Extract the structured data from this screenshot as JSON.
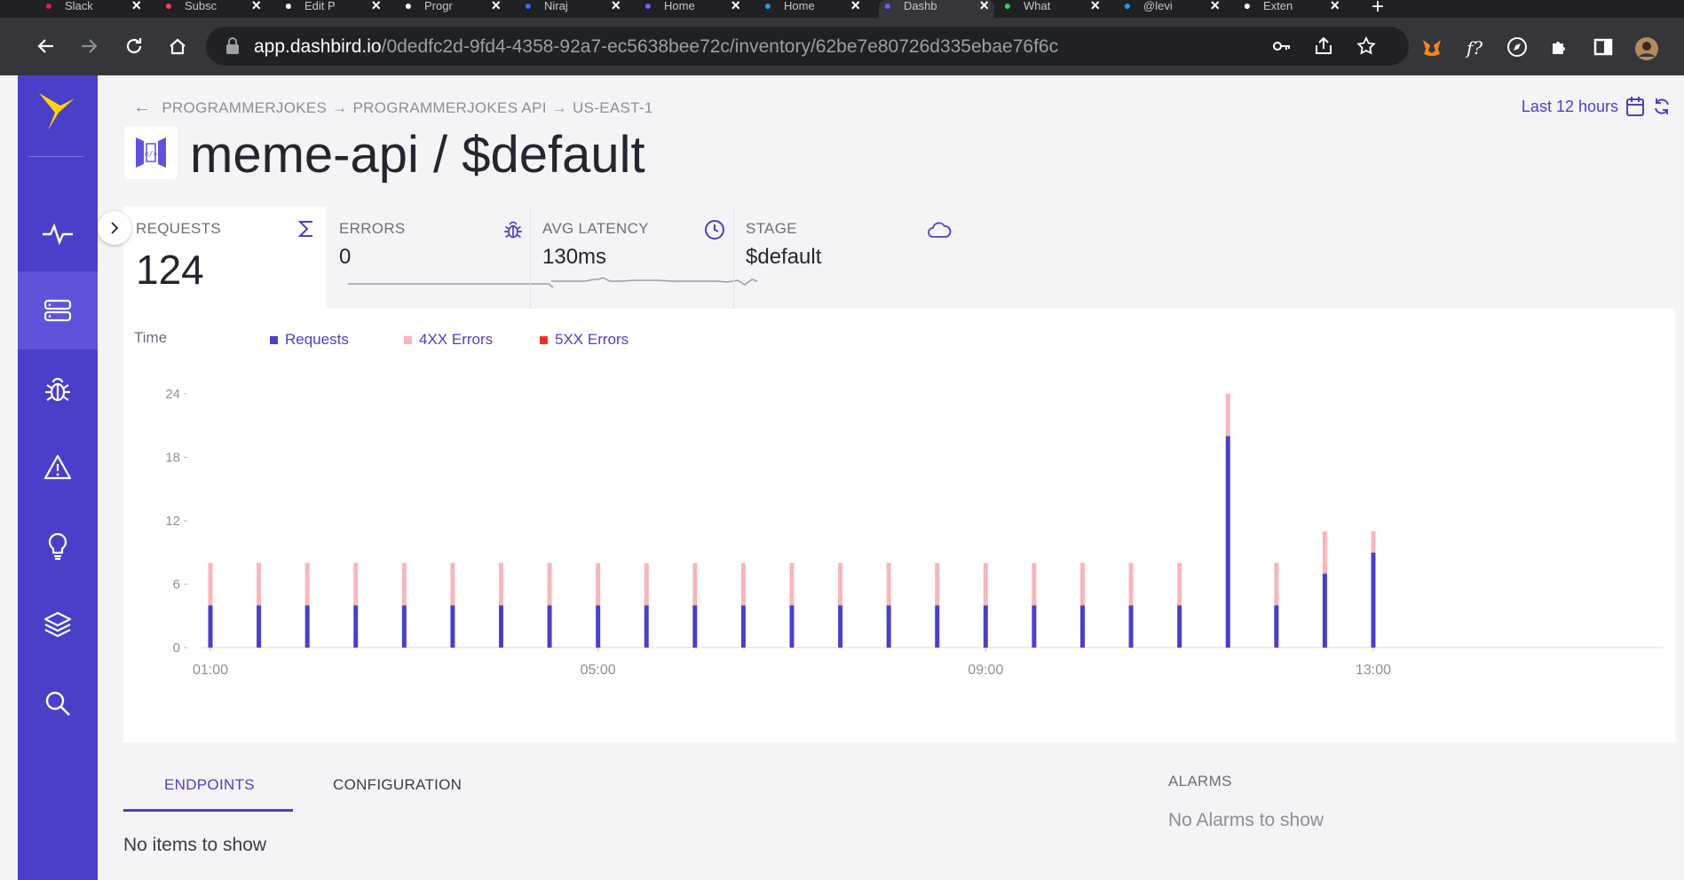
{
  "browser": {
    "tabs": [
      {
        "title": "Slack",
        "icon": "slack-icon",
        "color": "#e01e5a"
      },
      {
        "title": "Subsc",
        "icon": "swirl-icon",
        "color": "#ff3b5c"
      },
      {
        "title": "Edit P",
        "icon": "dollar-icon",
        "color": "#ffffff"
      },
      {
        "title": "Progr",
        "icon": "dollar-icon",
        "color": "#ffffff"
      },
      {
        "title": "Niraj",
        "icon": "circle-icon",
        "color": "#2f6fed"
      },
      {
        "title": "Home",
        "icon": "s-icon",
        "color": "#7b5cff"
      },
      {
        "title": "Home",
        "icon": "twitter-icon",
        "color": "#1d9bf0"
      },
      {
        "title": "Dashb",
        "icon": "dashbird-icon",
        "color": "#6d5dfc"
      },
      {
        "title": "What",
        "icon": "whatsapp-icon",
        "color": "#25d366"
      },
      {
        "title": "@levi",
        "icon": "twitter-icon",
        "color": "#1d9bf0"
      },
      {
        "title": "Exten",
        "icon": "puzzle-icon",
        "color": "#ffffff"
      }
    ],
    "url_host": "app.dashbird.io",
    "url_path": "/0dedfc2d-9fd4-4358-92a7-ec5638bee72c/inventory/62be7e80726d335ebae76f6c"
  },
  "breadcrumb": {
    "arrow": "←",
    "items": [
      "PROGRAMMERJOKES",
      "PROGRAMMERJOKES API",
      "US-EAST-1"
    ],
    "separator": "→"
  },
  "time_range": "Last 12 hours",
  "title": "meme-api / $default",
  "stats": {
    "requests": {
      "label": "REQUESTS",
      "value": "124"
    },
    "errors": {
      "label": "ERRORS",
      "value": "0"
    },
    "latency": {
      "label": "AVG LATENCY",
      "value": "130ms"
    },
    "stage": {
      "label": "STAGE",
      "value": "$default"
    }
  },
  "colors": {
    "brand": "#4a3fc8",
    "requests": "#4a3fc8",
    "errors_4xx": "#f7b6bc",
    "errors_5xx": "#f2301f"
  },
  "chart_data": {
    "type": "bar",
    "stacked": true,
    "x_label": "Time",
    "legend": [
      "Requests",
      "4XX Errors",
      "5XX Errors"
    ],
    "x_ticks": [
      "01:00",
      "05:00",
      "09:00",
      "13:00"
    ],
    "y_ticks": [
      0,
      6,
      12,
      18,
      24
    ],
    "ylim": [
      0,
      25
    ],
    "categories": [
      "01:00",
      "01:30",
      "02:00",
      "02:30",
      "03:00",
      "03:30",
      "04:00",
      "04:30",
      "05:00",
      "05:30",
      "06:00",
      "06:30",
      "07:00",
      "07:30",
      "08:00",
      "08:30",
      "09:00",
      "09:30",
      "10:00",
      "10:30",
      "11:00",
      "11:30",
      "12:00",
      "12:30",
      "13:00"
    ],
    "series": [
      {
        "name": "Requests",
        "values": [
          4,
          4,
          4,
          4,
          4,
          4,
          4,
          4,
          4,
          4,
          4,
          4,
          4,
          4,
          4,
          4,
          4,
          4,
          4,
          4,
          4,
          20,
          4,
          7,
          9
        ]
      },
      {
        "name": "4XX Errors",
        "values": [
          4,
          4,
          4,
          4,
          4,
          4,
          4,
          4,
          4,
          4,
          4,
          4,
          4,
          4,
          4,
          4,
          4,
          4,
          4,
          4,
          4,
          4,
          4,
          4,
          2
        ]
      },
      {
        "name": "5XX Errors",
        "values": [
          0,
          0,
          0,
          0,
          0,
          0,
          0,
          0,
          0,
          0,
          0,
          0,
          0,
          0,
          0,
          0,
          0,
          0,
          0,
          0,
          0,
          0,
          0,
          0,
          0
        ]
      }
    ]
  },
  "tabs": {
    "endpoints": "ENDPOINTS",
    "configuration": "CONFIGURATION"
  },
  "endpoints_empty": "No items to show",
  "alarms": {
    "title": "ALARMS",
    "empty": "No Alarms to show"
  }
}
